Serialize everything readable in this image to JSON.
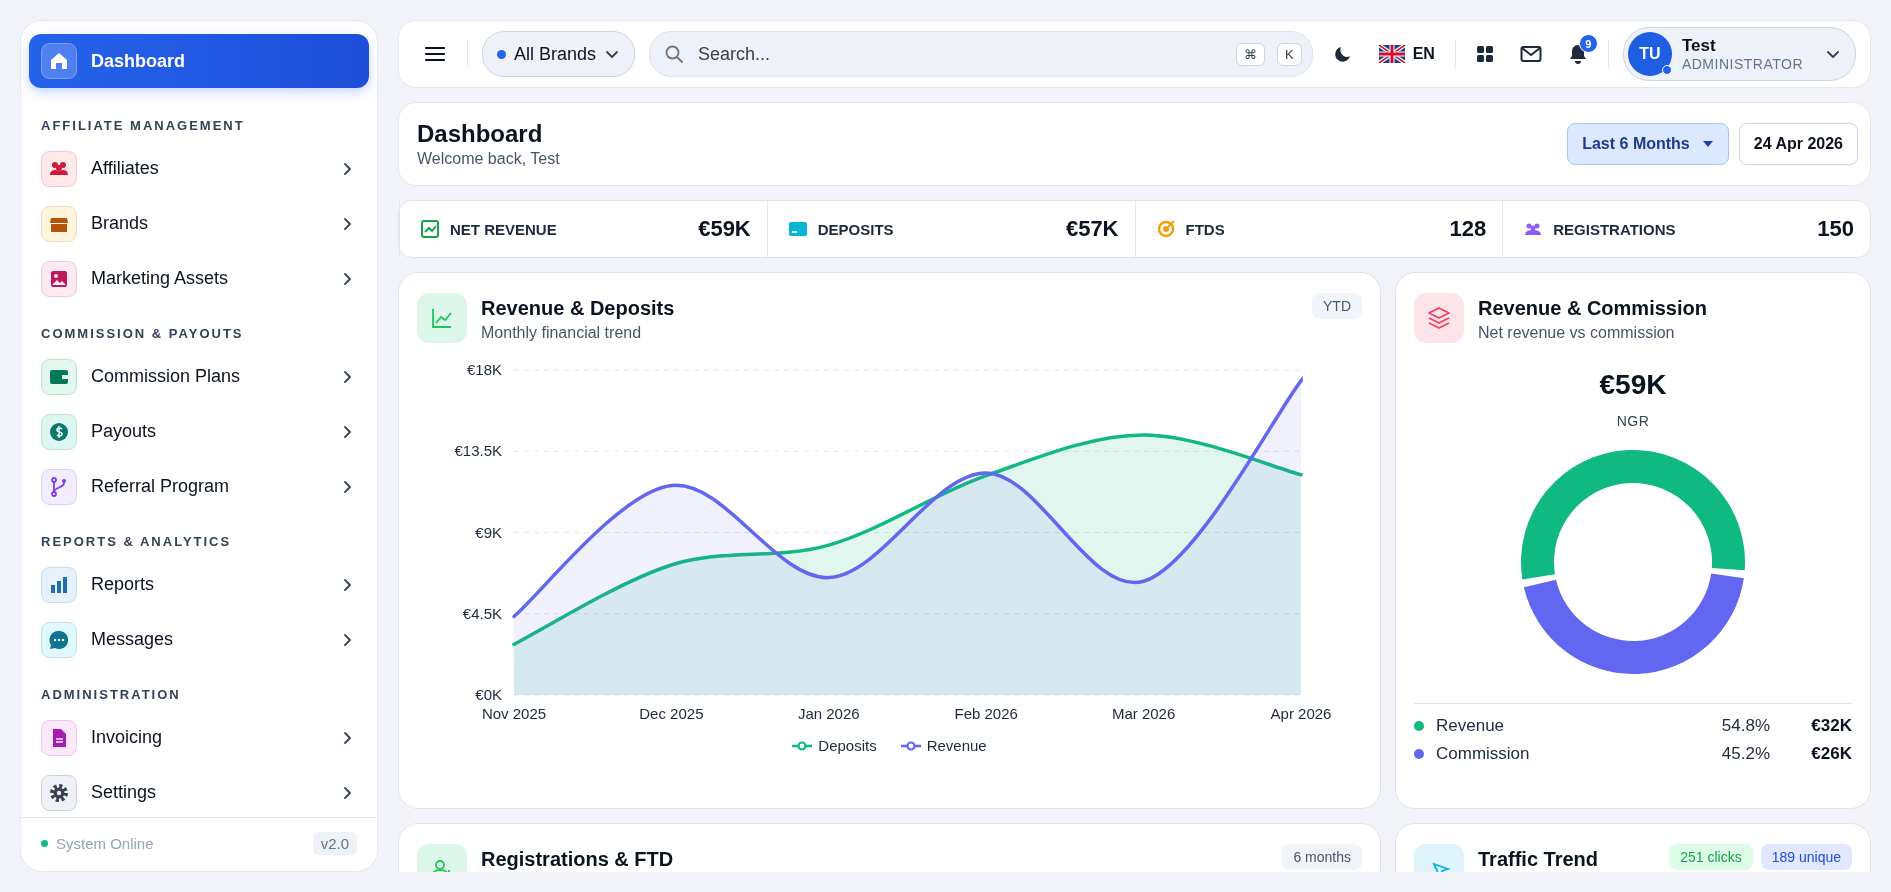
{
  "sidebar": {
    "top_items": [
      {
        "label": "Dashboard",
        "selected": true
      }
    ],
    "sections": [
      {
        "title": "AFFILIATE MANAGEMENT",
        "items": [
          {
            "label": "Affiliates",
            "selected": false
          },
          {
            "label": "Brands",
            "selected": false
          },
          {
            "label": "Marketing Assets",
            "selected": false
          }
        ]
      },
      {
        "title": "COMMISSION & PAYOUTS",
        "items": [
          {
            "label": "Commission Plans",
            "selected": false
          },
          {
            "label": "Payouts",
            "selected": false
          },
          {
            "label": "Referral Program",
            "selected": false
          }
        ]
      },
      {
        "title": "REPORTS & ANALYTICS",
        "items": [
          {
            "label": "Reports",
            "selected": false
          },
          {
            "label": "Messages",
            "selected": false
          }
        ]
      },
      {
        "title": "ADMINISTRATION",
        "items": [
          {
            "label": "Invoicing",
            "selected": false
          },
          {
            "label": "Settings",
            "selected": false
          }
        ]
      }
    ],
    "footer": {
      "status": "System Online",
      "version": "v2.0"
    }
  },
  "top_bar": {
    "brand_selector": "All Brands",
    "search": {
      "placeholder": "Search..."
    },
    "shortcut_keys": [
      "⌘",
      "K"
    ],
    "language": "EN",
    "notification_count": "9",
    "user": {
      "initials": "TU",
      "name": "Test",
      "role": "ADMINISTRATOR"
    }
  },
  "header": {
    "title": "Dashboard",
    "subtitle": "Welcome back, Test",
    "period": "Last 6 Months",
    "date": "24 Apr 2026"
  },
  "stats": [
    {
      "label": "NET REVENUE",
      "value": "€59K"
    },
    {
      "label": "DEPOSITS",
      "value": "€57K"
    },
    {
      "label": "FTDS",
      "value": "128"
    },
    {
      "label": "REGISTRATIONS",
      "value": "150"
    }
  ],
  "revenue_deposits": {
    "title": "Revenue & Deposits",
    "subtitle": "Monthly financial trend",
    "badge": "YTD",
    "chart_data": {
      "type": "area",
      "grid": true,
      "categories": [
        "Nov 2025",
        "Dec 2025",
        "Jan 2026",
        "Feb 2026",
        "Mar 2026",
        "Apr 2026"
      ],
      "ylim": [
        0,
        18000
      ],
      "yticks": [
        {
          "value": 0,
          "label": "€0K"
        },
        {
          "value": 4500,
          "label": "€4.5K"
        },
        {
          "value": 9000,
          "label": "€9K"
        },
        {
          "value": 13500,
          "label": "€13.5K"
        },
        {
          "value": 18000,
          "label": "€18K"
        }
      ],
      "series": [
        {
          "name": "Deposits",
          "color": "#10b981",
          "values": [
            2800,
            7200,
            8300,
            12150,
            14400,
            12200
          ]
        },
        {
          "name": "Revenue",
          "color": "#6366f1",
          "values": [
            4350,
            11600,
            6500,
            12300,
            6300,
            17400
          ]
        }
      ]
    }
  },
  "revenue_commission": {
    "title": "Revenue & Commission",
    "subtitle": "Net revenue vs commission",
    "total": "€59K",
    "total_label": "NGR",
    "chart_data": {
      "type": "donut",
      "categories": [
        "Revenue",
        "Commission"
      ],
      "values": [
        54.8,
        45.2
      ]
    },
    "legend": [
      {
        "share": "54.8%",
        "amount": "€32K",
        "color": "#10b981"
      },
      {
        "share": "45.2%",
        "amount": "€26K",
        "color": "#6366f1"
      }
    ]
  },
  "registrations_ftd": {
    "title": "Registrations & FTD",
    "badge": "6 months"
  },
  "traffic_trend": {
    "title": "Traffic Trend",
    "badges": [
      "251 clicks",
      "189 unique"
    ]
  }
}
